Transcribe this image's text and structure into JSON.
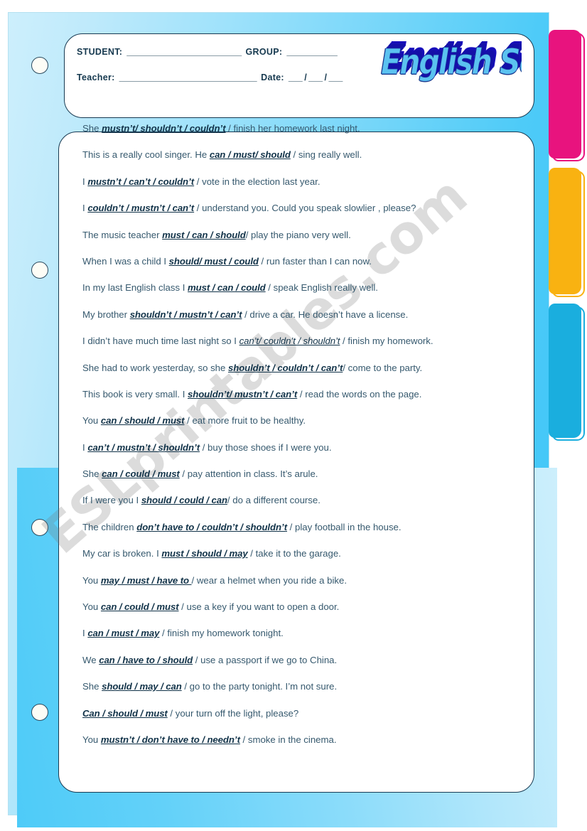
{
  "document": {
    "type": "worksheet",
    "subject": "Modal verbs multiple choice"
  },
  "header": {
    "student_label": "STUDENT:",
    "student_rule": "_________________________",
    "group_label": "GROUP:",
    "group_rule": "___________",
    "teacher_label": "Teacher:",
    "teacher_rule": "______________________________",
    "date_label": "Date:",
    "date_rule": "___ / ___ / ___",
    "logo_text": "English School"
  },
  "watermark": {
    "text": "ESLprintables.com"
  },
  "tabs": [
    {
      "name": "pink-tab",
      "color": "#e8137e"
    },
    {
      "name": "yellow-tab",
      "color": "#f9b211"
    },
    {
      "name": "cyan-tab",
      "color": "#1aaede"
    }
  ],
  "colors": {
    "page_light": "#cdeffc",
    "page_deep": "#3ec5f7",
    "ink": "#23455c",
    "card_border": "#183a52",
    "logo_face": "#5bc2f0",
    "logo_shadow": "#1510a8"
  },
  "exercises": [
    {
      "pre": "She ",
      "choices": "mustn’t/ shouldn’t /  couldn’t",
      "post": " /  finish her homework last night."
    },
    {
      "pre": "This is a really cool singer. He ",
      "choices": "can / must/  should",
      "post": " / sing really well."
    },
    {
      "pre": "I ",
      "choices": "mustn’t /  can’t /  couldn’t",
      "post": "  /  vote in the election last year."
    },
    {
      "pre": "I ",
      "choices": "couldn’t /  mustn’t  / can’t",
      "post": " /  understand you. Could you speak  slowlier , please?"
    },
    {
      "pre": "The music teacher ",
      "choices": "must / can /  should",
      "post": "/  play the piano very well."
    },
    {
      "pre": "When I was a child I ",
      "choices": "should/  must / could",
      "post": " /  run faster than I can now."
    },
    {
      "pre": "In my last English class I ",
      "choices": "must / can / could",
      "post": " /  speak English really well."
    },
    {
      "pre": "My brother ",
      "choices": "shouldn’t / mustn’t / can’t",
      "post": " / drive a car. He doesn’t have a license."
    },
    {
      "pre": "I didn’t have much time last night so I ",
      "choices": "can’t/ couldn’t /  shouldn’t",
      "post": " / finish my homework.",
      "plain": true
    },
    {
      "pre": "She had to work yesterday, so she ",
      "choices": "shouldn’t / couldn’t / can’t",
      "post": "/  come to the party."
    },
    {
      "pre": "This book is very small. I ",
      "choices": "shouldn’t/ mustn’t / can’t",
      "post": "  /  read the words on the page."
    },
    {
      "pre": "You ",
      "choices": "can /  should /  must",
      "post": " /  eat more fruit to be healthy."
    },
    {
      "pre": "I ",
      "choices": "can’t / mustn’t / shouldn’t",
      "post": " /  buy those shoes if I were you."
    },
    {
      "pre": "She ",
      "choices": "can /  could /  must",
      "post": " /  pay attention in class. It’s arule."
    },
    {
      "pre": "If I were you I ",
      "choices": "should / could /  can",
      "post": "/  do a different course."
    },
    {
      "pre": "The children ",
      "choices": "don’t have to / couldn’t / shouldn’t",
      "post": " / play football in the house."
    },
    {
      "pre": "My car is broken. I ",
      "choices": "must /  should /  may",
      "post": " / take it to the garage."
    },
    {
      "pre": "You ",
      "choices": "may / must / have to ",
      "post": "/  wear a helmet when you ride a bike."
    },
    {
      "pre": "You ",
      "choices": "can / could /  must",
      "post": " /  use a key if you want to open a door."
    },
    {
      "pre": "I ",
      "choices": "can / must / may",
      "post": " /  finish my homework tonight."
    },
    {
      "pre": "We ",
      "choices": "can /  have to /  should",
      "post": " /  use a passport if we go to China."
    },
    {
      "pre": "She ",
      "choices": "should / may / can",
      "post": " /  go to the party tonight. I’m not sure."
    },
    {
      "pre": "",
      "choices": "Can / should /  must",
      "post": " /  your turn off the  light, please?"
    },
    {
      "pre": "You ",
      "choices": " mustn’t /  don’t have to / needn’t",
      "post": " / smoke in the cinema."
    }
  ]
}
